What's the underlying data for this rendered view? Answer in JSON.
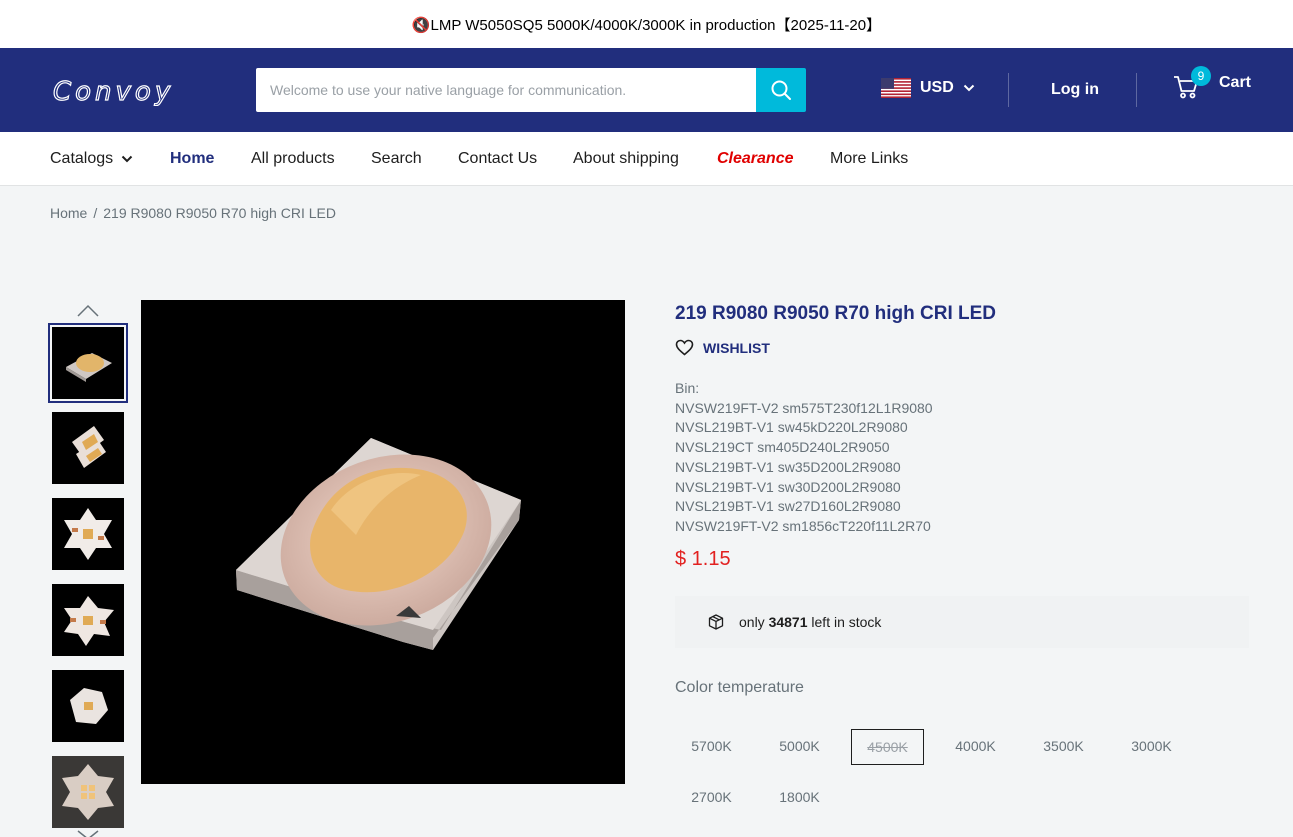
{
  "announcement": "🔇LMP W5050SQ5 5000K/4000K/3000K in production【2025-11-20】",
  "header": {
    "logo": "Convoy",
    "search_placeholder": "Welcome to use your native language for communication.",
    "currency": "USD",
    "login": "Log in",
    "cart_label": "Cart",
    "cart_count": "9"
  },
  "nav": {
    "items": [
      "Catalogs",
      "Home",
      "All products",
      "Search",
      "Contact Us",
      "About shipping",
      "Clearance",
      "More Links"
    ],
    "active": "Home"
  },
  "breadcrumb": {
    "home": "Home",
    "separator": "/",
    "current": "219 R9080 R9050 R70 high CRI LED"
  },
  "gallery": {
    "thumbnails": [
      "led-chip-angle-view",
      "led-chip-side-view",
      "star-board-white",
      "star-board-white-angled",
      "round-board-white",
      "star-board-quad"
    ],
    "selected_index": 0,
    "main_image": "led-chip-closeup"
  },
  "product": {
    "title": "219 R9080 R9050 R70 high CRI LED",
    "wishlist": "WISHLIST",
    "bin_label": "Bin:",
    "bins": [
      "NVSW219FT-V2 sm575T230f12L1R9080",
      "NVSL219BT-V1 sw45kD220L2R9080",
      "NVSL219CT sm405D240L2R9050",
      "NVSL219BT-V1 sw35D200L2R9080",
      "NVSL219BT-V1 sw30D200L2R9080",
      "NVSL219BT-V1 sw27D160L2R9080",
      "NVSW219FT-V2 sm1856cT220f11L2R70"
    ],
    "price": "$ 1.15",
    "stock_prefix": "only",
    "stock_count": "34871",
    "stock_suffix": "left in stock",
    "color_label": "Color temperature",
    "colors": [
      "5700K",
      "5000K",
      "4500K",
      "4000K",
      "3500K",
      "3000K",
      "2700K",
      "1800K"
    ],
    "selected_color": "4500K"
  },
  "colors": {
    "header_bg": "#212e7d",
    "accent": "#00badb",
    "price": "#e22120",
    "clearance": "#e00000"
  }
}
